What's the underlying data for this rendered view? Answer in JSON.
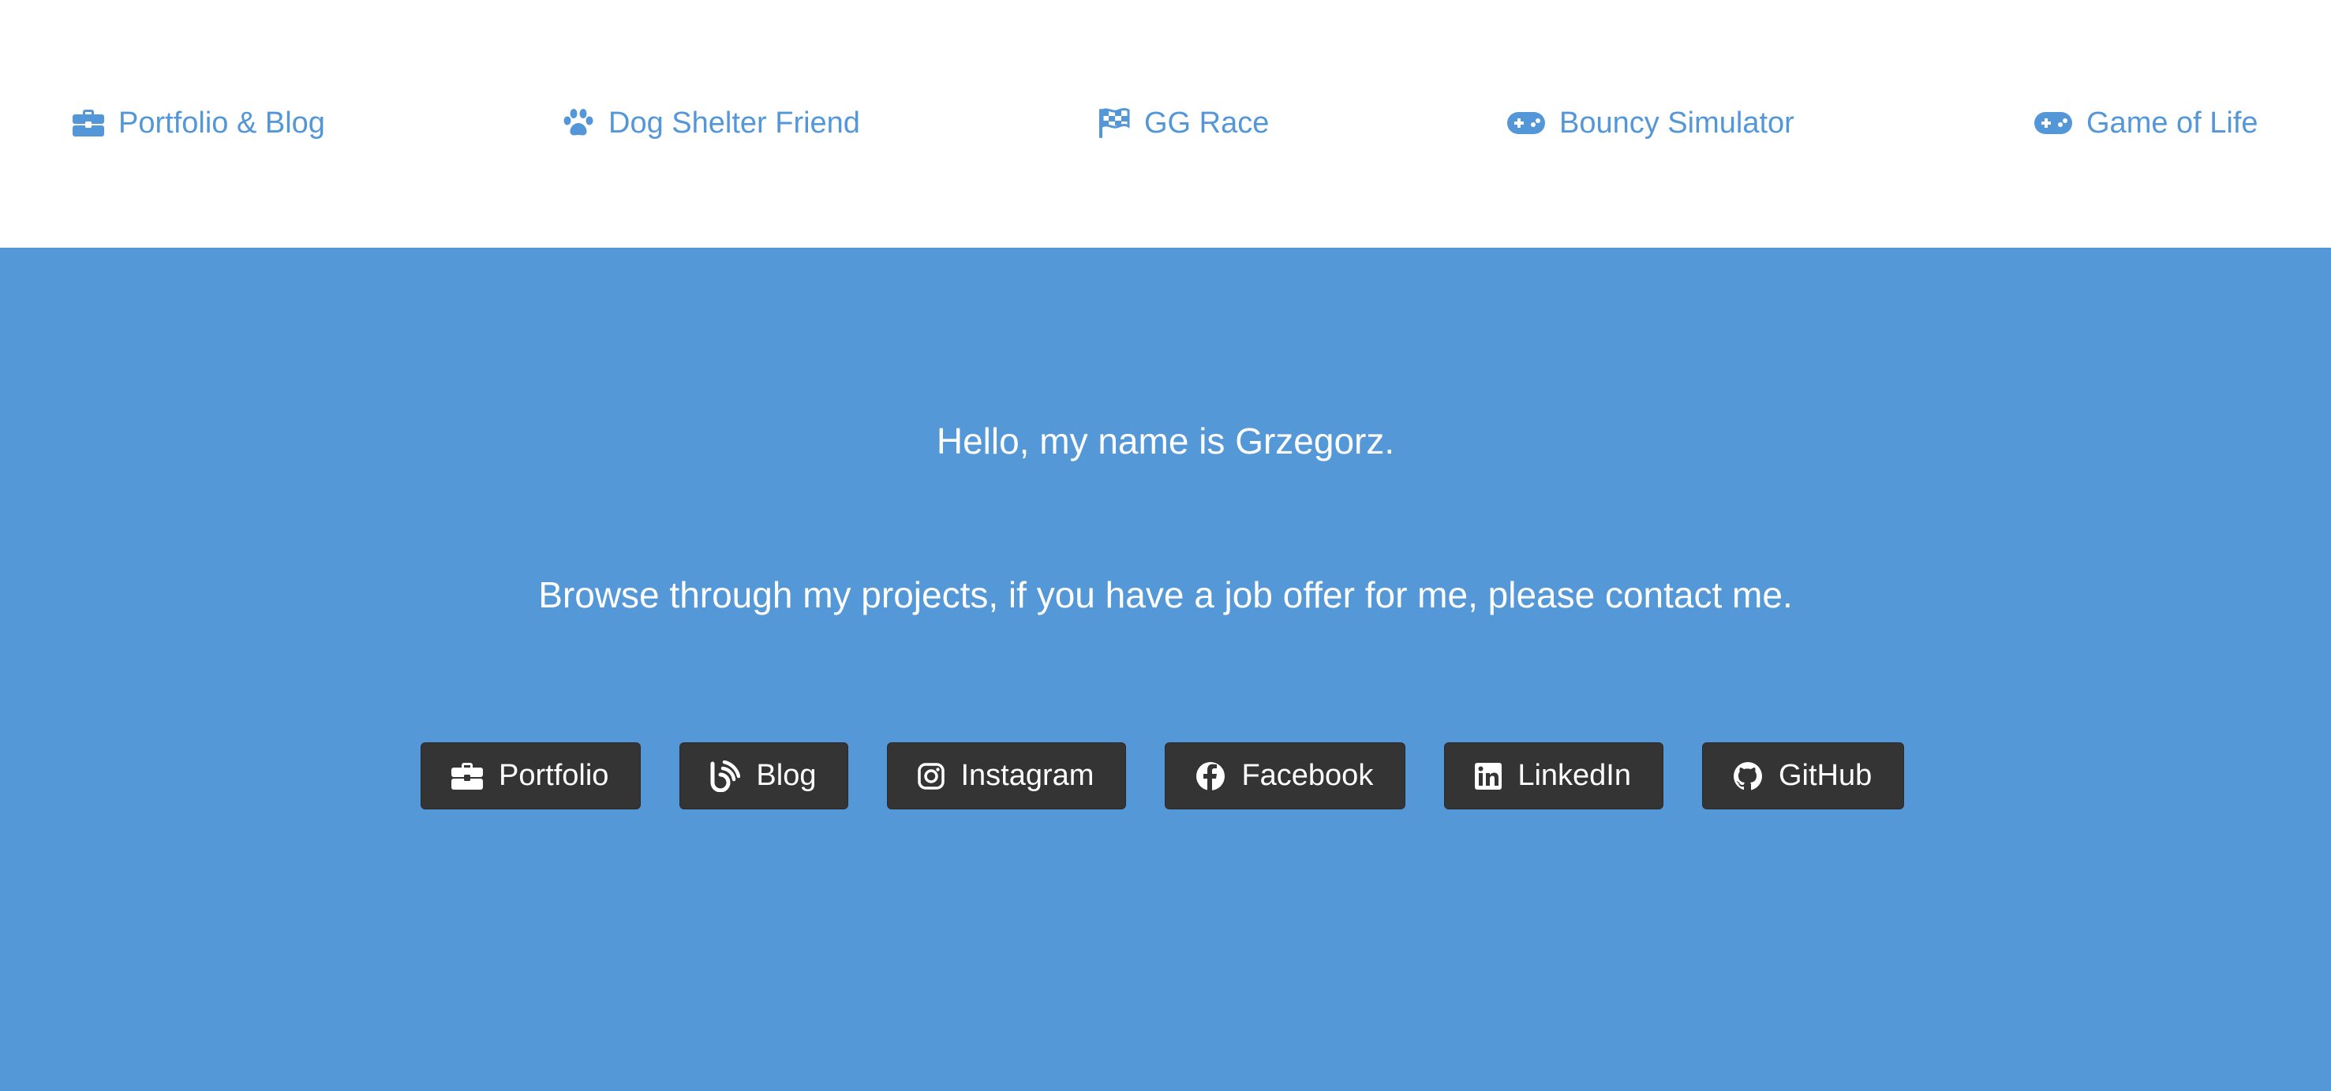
{
  "colors": {
    "accent": "#5497d8",
    "hero_background": "#5598d8",
    "button_background": "#343434",
    "text_light": "#ffffff"
  },
  "nav": {
    "items": [
      {
        "label": "Portfolio & Blog",
        "icon": "briefcase-icon"
      },
      {
        "label": "Dog Shelter Friend",
        "icon": "paw-icon"
      },
      {
        "label": "GG Race",
        "icon": "checkered-flag-icon"
      },
      {
        "label": "Bouncy Simulator",
        "icon": "gamepad-icon"
      },
      {
        "label": "Game of Life",
        "icon": "gamepad-icon"
      }
    ]
  },
  "hero": {
    "greeting": "Hello, my name is Grzegorz.",
    "message": "Browse through my projects, if you have a job offer for me, please contact me."
  },
  "social": {
    "buttons": [
      {
        "label": "Portfolio",
        "icon": "briefcase-icon"
      },
      {
        "label": "Blog",
        "icon": "blog-icon"
      },
      {
        "label": "Instagram",
        "icon": "instagram-icon"
      },
      {
        "label": "Facebook",
        "icon": "facebook-icon"
      },
      {
        "label": "LinkedIn",
        "icon": "linkedin-icon"
      },
      {
        "label": "GitHub",
        "icon": "github-icon"
      }
    ]
  }
}
